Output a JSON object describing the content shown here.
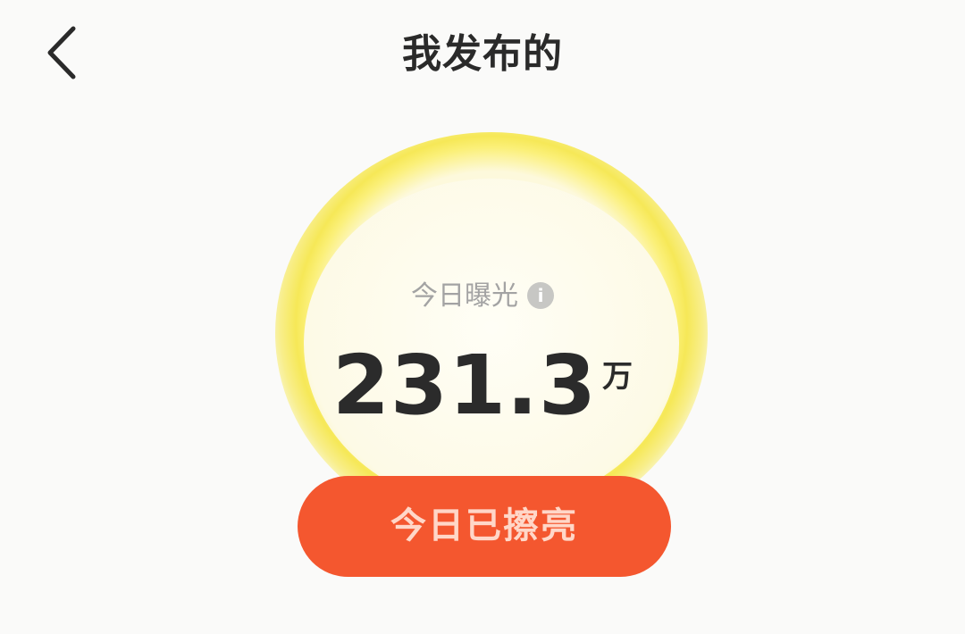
{
  "header": {
    "title": "我发布的",
    "back_icon": "chevron-left-icon"
  },
  "stat": {
    "label": "今日曝光",
    "info_icon_glyph": "i",
    "value": "231.3",
    "unit": "万"
  },
  "action": {
    "label": "今日已擦亮"
  },
  "colors": {
    "accent": "#f4572f",
    "halo": "#f6e857",
    "text_dark": "#2b2b2b",
    "text_muted": "#a3a3a3"
  }
}
